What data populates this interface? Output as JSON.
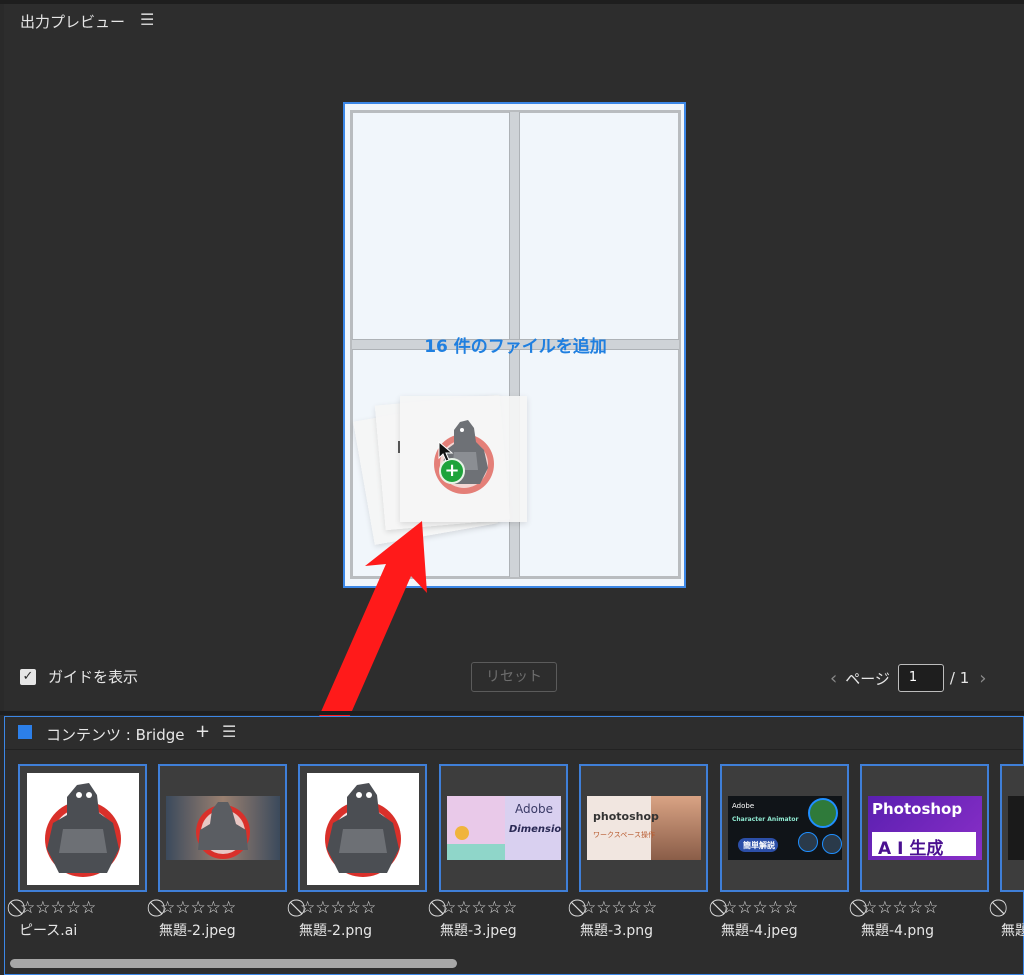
{
  "preview_panel": {
    "title": "出力プレビュー",
    "drop_label": "16 件のファイルを追加",
    "guide_label": "ガイドを表示",
    "guide_checked": true,
    "reset_label": "リセット",
    "page_label": "ページ",
    "page_value": "1",
    "page_total": "/ 1"
  },
  "content_panel": {
    "title": "コンテンツ : Bridge",
    "items": [
      {
        "filename": "ピース.ai",
        "rating": "⃠☆☆☆☆☆"
      },
      {
        "filename": "無題-2.jpeg",
        "rating": "⃠☆☆☆☆☆"
      },
      {
        "filename": "無題-2.png",
        "rating": "⃠☆☆☆☆☆"
      },
      {
        "filename": "無題-3.jpeg",
        "rating": "⃠☆☆☆☆☆"
      },
      {
        "filename": "無題-3.png",
        "rating": "⃠☆☆☆☆☆"
      },
      {
        "filename": "無題-4.jpeg",
        "rating": "⃠☆☆☆☆☆"
      },
      {
        "filename": "無題-4.png",
        "rating": "⃠☆☆☆☆☆"
      },
      {
        "filename": "無題",
        "rating": "⃠"
      }
    ],
    "thumb_text": {
      "adobe": "Adobe",
      "dimension": "Dimension",
      "photoshop_lower": "photoshop",
      "workspace": "ワークスペース操作",
      "adobe2": "Adobe",
      "character": "Character Animator",
      "kantan": "簡単解説",
      "photoshop": "Photoshop",
      "ai_gen": "A I 生成"
    }
  },
  "icons": {
    "panel_menu": "hamburger-icon",
    "add": "plus-icon",
    "prev": "chevron-left-icon",
    "next": "chevron-right-icon"
  },
  "colors": {
    "accent": "#3c87e6",
    "drop_label": "#1f7fe0",
    "arrow": "#ff1a1a",
    "plus_badge": "#1ea33b"
  }
}
